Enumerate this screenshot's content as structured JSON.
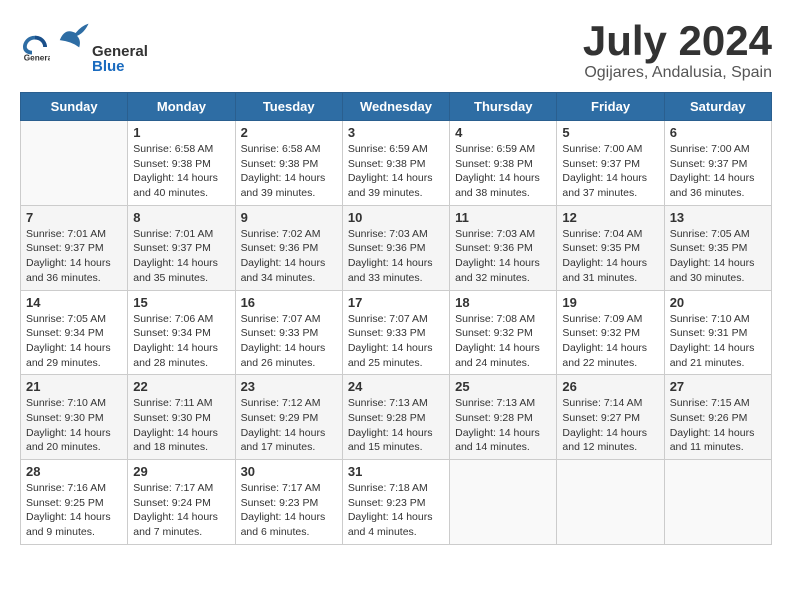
{
  "header": {
    "logo": {
      "text_general": "General",
      "text_blue": "Blue"
    },
    "title": "July 2024",
    "subtitle": "Ogijares, Andalusia, Spain"
  },
  "calendar": {
    "days_of_week": [
      "Sunday",
      "Monday",
      "Tuesday",
      "Wednesday",
      "Thursday",
      "Friday",
      "Saturday"
    ],
    "weeks": [
      [
        {
          "day": "",
          "content": ""
        },
        {
          "day": "1",
          "content": "Sunrise: 6:58 AM\nSunset: 9:38 PM\nDaylight: 14 hours\nand 40 minutes."
        },
        {
          "day": "2",
          "content": "Sunrise: 6:58 AM\nSunset: 9:38 PM\nDaylight: 14 hours\nand 39 minutes."
        },
        {
          "day": "3",
          "content": "Sunrise: 6:59 AM\nSunset: 9:38 PM\nDaylight: 14 hours\nand 39 minutes."
        },
        {
          "day": "4",
          "content": "Sunrise: 6:59 AM\nSunset: 9:38 PM\nDaylight: 14 hours\nand 38 minutes."
        },
        {
          "day": "5",
          "content": "Sunrise: 7:00 AM\nSunset: 9:37 PM\nDaylight: 14 hours\nand 37 minutes."
        },
        {
          "day": "6",
          "content": "Sunrise: 7:00 AM\nSunset: 9:37 PM\nDaylight: 14 hours\nand 36 minutes."
        }
      ],
      [
        {
          "day": "7",
          "content": "Sunrise: 7:01 AM\nSunset: 9:37 PM\nDaylight: 14 hours\nand 36 minutes."
        },
        {
          "day": "8",
          "content": "Sunrise: 7:01 AM\nSunset: 9:37 PM\nDaylight: 14 hours\nand 35 minutes."
        },
        {
          "day": "9",
          "content": "Sunrise: 7:02 AM\nSunset: 9:36 PM\nDaylight: 14 hours\nand 34 minutes."
        },
        {
          "day": "10",
          "content": "Sunrise: 7:03 AM\nSunset: 9:36 PM\nDaylight: 14 hours\nand 33 minutes."
        },
        {
          "day": "11",
          "content": "Sunrise: 7:03 AM\nSunset: 9:36 PM\nDaylight: 14 hours\nand 32 minutes."
        },
        {
          "day": "12",
          "content": "Sunrise: 7:04 AM\nSunset: 9:35 PM\nDaylight: 14 hours\nand 31 minutes."
        },
        {
          "day": "13",
          "content": "Sunrise: 7:05 AM\nSunset: 9:35 PM\nDaylight: 14 hours\nand 30 minutes."
        }
      ],
      [
        {
          "day": "14",
          "content": "Sunrise: 7:05 AM\nSunset: 9:34 PM\nDaylight: 14 hours\nand 29 minutes."
        },
        {
          "day": "15",
          "content": "Sunrise: 7:06 AM\nSunset: 9:34 PM\nDaylight: 14 hours\nand 28 minutes."
        },
        {
          "day": "16",
          "content": "Sunrise: 7:07 AM\nSunset: 9:33 PM\nDaylight: 14 hours\nand 26 minutes."
        },
        {
          "day": "17",
          "content": "Sunrise: 7:07 AM\nSunset: 9:33 PM\nDaylight: 14 hours\nand 25 minutes."
        },
        {
          "day": "18",
          "content": "Sunrise: 7:08 AM\nSunset: 9:32 PM\nDaylight: 14 hours\nand 24 minutes."
        },
        {
          "day": "19",
          "content": "Sunrise: 7:09 AM\nSunset: 9:32 PM\nDaylight: 14 hours\nand 22 minutes."
        },
        {
          "day": "20",
          "content": "Sunrise: 7:10 AM\nSunset: 9:31 PM\nDaylight: 14 hours\nand 21 minutes."
        }
      ],
      [
        {
          "day": "21",
          "content": "Sunrise: 7:10 AM\nSunset: 9:30 PM\nDaylight: 14 hours\nand 20 minutes."
        },
        {
          "day": "22",
          "content": "Sunrise: 7:11 AM\nSunset: 9:30 PM\nDaylight: 14 hours\nand 18 minutes."
        },
        {
          "day": "23",
          "content": "Sunrise: 7:12 AM\nSunset: 9:29 PM\nDaylight: 14 hours\nand 17 minutes."
        },
        {
          "day": "24",
          "content": "Sunrise: 7:13 AM\nSunset: 9:28 PM\nDaylight: 14 hours\nand 15 minutes."
        },
        {
          "day": "25",
          "content": "Sunrise: 7:13 AM\nSunset: 9:28 PM\nDaylight: 14 hours\nand 14 minutes."
        },
        {
          "day": "26",
          "content": "Sunrise: 7:14 AM\nSunset: 9:27 PM\nDaylight: 14 hours\nand 12 minutes."
        },
        {
          "day": "27",
          "content": "Sunrise: 7:15 AM\nSunset: 9:26 PM\nDaylight: 14 hours\nand 11 minutes."
        }
      ],
      [
        {
          "day": "28",
          "content": "Sunrise: 7:16 AM\nSunset: 9:25 PM\nDaylight: 14 hours\nand 9 minutes."
        },
        {
          "day": "29",
          "content": "Sunrise: 7:17 AM\nSunset: 9:24 PM\nDaylight: 14 hours\nand 7 minutes."
        },
        {
          "day": "30",
          "content": "Sunrise: 7:17 AM\nSunset: 9:23 PM\nDaylight: 14 hours\nand 6 minutes."
        },
        {
          "day": "31",
          "content": "Sunrise: 7:18 AM\nSunset: 9:23 PM\nDaylight: 14 hours\nand 4 minutes."
        },
        {
          "day": "",
          "content": ""
        },
        {
          "day": "",
          "content": ""
        },
        {
          "day": "",
          "content": ""
        }
      ]
    ]
  }
}
